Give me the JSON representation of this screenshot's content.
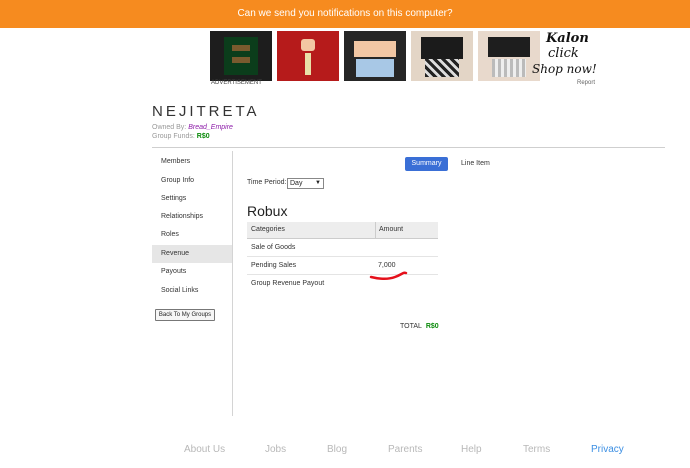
{
  "notification": {
    "text": "Can we send you notifications on this computer?"
  },
  "ad": {
    "label": "ADVERTISEMENT",
    "report": "Report",
    "brand_line1": "Kalon",
    "brand_line2": "click",
    "brand_line3": "Shop now!"
  },
  "group": {
    "name": "NEJITRETA",
    "owned_label": "Owned By:",
    "owner": "Bread_Empire",
    "funds_label": "Group Funds:",
    "funds_value": "R$0"
  },
  "sidebar": {
    "items": [
      {
        "label": "Members"
      },
      {
        "label": "Group Info"
      },
      {
        "label": "Settings"
      },
      {
        "label": "Relationships"
      },
      {
        "label": "Roles"
      },
      {
        "label": "Revenue"
      },
      {
        "label": "Payouts"
      },
      {
        "label": "Social Links"
      }
    ],
    "active": "Revenue",
    "back_button": "Back To My Groups"
  },
  "view_tabs": {
    "summary": "Summary",
    "line_item": "Line Item"
  },
  "time_period": {
    "label": "Time Period:",
    "value": "Day"
  },
  "section_title": "Robux",
  "table": {
    "headers": [
      "Categories",
      "Amount"
    ],
    "rows": [
      {
        "category": "Sale of Goods",
        "amount": ""
      },
      {
        "category": "Pending Sales",
        "amount": "7,000"
      },
      {
        "category": "Group Revenue Payout",
        "amount": ""
      }
    ]
  },
  "total": {
    "label": "TOTAL",
    "value": "R$0"
  },
  "footer": {
    "links": [
      "About Us",
      "Jobs",
      "Blog",
      "Parents",
      "Help",
      "Terms",
      "Privacy"
    ]
  },
  "colors": {
    "notification_bg": "#f68b1f",
    "primary_button": "#3a6fd6",
    "robux_green": "#0a8a0a",
    "annotation_red": "#e5101b",
    "privacy_link": "#3c8fe3"
  }
}
